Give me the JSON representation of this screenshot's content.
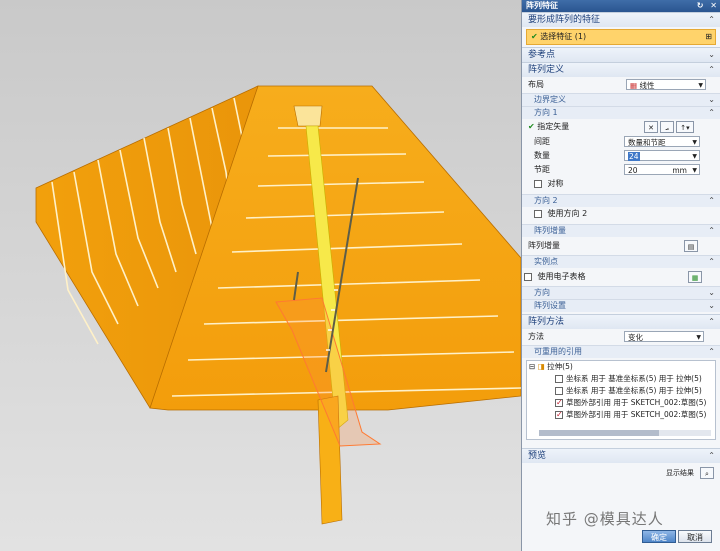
{
  "dialog": {
    "title": "阵列特征",
    "sections": {
      "feature": "要形成阵列的特征",
      "select_feature": "选择特征 (1)",
      "reference": "参考点",
      "pattern_def": "阵列定义",
      "method": "阵列方法",
      "preview": "预览"
    },
    "layout": {
      "label": "布局",
      "value": "线性"
    },
    "boundary": "边界定义",
    "direction1": {
      "header": "方向 1",
      "specify_vector": "指定矢量",
      "spacing_label": "间距",
      "spacing_value": "数量和节距",
      "count_label": "数量",
      "count_value": "24",
      "pitch_label": "节距",
      "pitch_value": "20",
      "pitch_unit": "mm",
      "symmetric": "对称"
    },
    "direction2": {
      "header": "方向 2",
      "use_dir2": "使用方向 2"
    },
    "increment": {
      "header": "阵列增量",
      "label": "阵列增量"
    },
    "instance": {
      "header": "实例点",
      "spreadsheet": "使用电子表格"
    },
    "orientation": "方向",
    "settings": "阵列设置",
    "method": {
      "label": "方法",
      "value": "变化"
    },
    "reusable": {
      "header": "可重用的引用",
      "root": "拉伸(5)",
      "items": [
        {
          "text": "坐标系 用于 基准坐标系(5) 用于 拉伸(5)",
          "checked": false
        },
        {
          "text": "坐标系 用于 基准坐标系(5) 用于 拉伸(5)",
          "checked": false
        },
        {
          "text": "草图外部引用 用于 SKETCH_002:草图(5)",
          "checked": true
        },
        {
          "text": "草图外部引用 用于 SKETCH_002:草图(5)",
          "checked": true
        }
      ]
    },
    "show_result": "显示结果",
    "ok": "确定",
    "cancel": "取消"
  },
  "watermark": "知乎 @模具达人",
  "colors": {
    "part_orange": "#f5a30c",
    "title_blue": "#2f5c93",
    "selection_yellow": "#ffd36b"
  }
}
